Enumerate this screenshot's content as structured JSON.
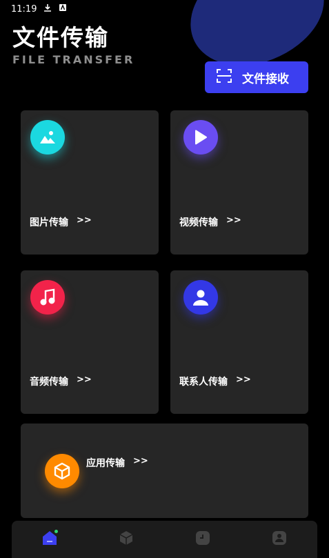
{
  "status": {
    "time": "11:19"
  },
  "header": {
    "title": "文件传输",
    "subtitle": "FILE TRANSFER",
    "receive_label": "文件接收"
  },
  "cards": {
    "image": {
      "label": "图片传输",
      "arrow": ">>",
      "color": "#1bd8e0"
    },
    "video": {
      "label": "视频传输",
      "arrow": ">>",
      "color": "#6a4df2"
    },
    "audio": {
      "label": "音频传输",
      "arrow": ">>",
      "color": "#f2234a"
    },
    "contact": {
      "label": "联系人传输",
      "arrow": ">>",
      "color": "#3338e6"
    },
    "app": {
      "label": "应用传输",
      "arrow": ">>",
      "color": "#ff8a00"
    }
  },
  "nav": {
    "items": [
      {
        "icon": "home-icon",
        "active": true
      },
      {
        "icon": "box-icon",
        "active": false
      },
      {
        "icon": "clock-icon",
        "active": false
      },
      {
        "icon": "user-icon",
        "active": false
      }
    ],
    "accent": "#3c3ff0"
  }
}
